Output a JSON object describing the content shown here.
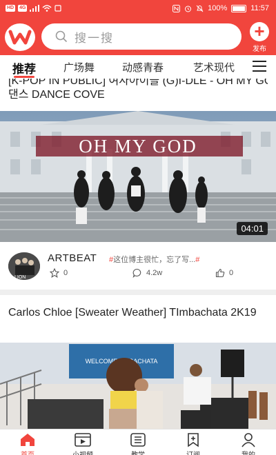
{
  "status_bar": {
    "left_badge_1": "HD",
    "left_badge_2": "4G",
    "battery_percent": "100%",
    "time": "11:57"
  },
  "header": {
    "search_placeholder": "搜一搜",
    "publish_label": "发布",
    "accent_color": "#f1453d"
  },
  "tabs": [
    {
      "label": "推荐",
      "active": true
    },
    {
      "label": "广场舞",
      "active": false
    },
    {
      "label": "动感青春",
      "active": false
    },
    {
      "label": "艺术现代",
      "active": false
    }
  ],
  "feed": [
    {
      "title_line1": "[K-POP IN PUBLIC] 여자아이들 (G)I-DLE - OH MY GOD + 커버",
      "title_line2": "댄스 DANCE COVE",
      "thumbnail_text": "OH MY GOD",
      "duration": "04:01",
      "author": "ARTBEAT",
      "hashtag": "这位博主很忙，忘了写...",
      "likes_star": "0",
      "comments": "4.2w",
      "thumbs": "0"
    },
    {
      "title": "Carlos  Chloe [Sweater Weather] TImbachata  2K19",
      "banner_text": "WELCOME TO BACHATA"
    }
  ],
  "bottom_nav": [
    {
      "label": "首页",
      "icon": "home-icon",
      "active": true
    },
    {
      "label": "小视频",
      "icon": "video-icon",
      "active": false
    },
    {
      "label": "教学",
      "icon": "teach-icon",
      "active": false
    },
    {
      "label": "订阅",
      "icon": "subscribe-icon",
      "active": false
    },
    {
      "label": "我的",
      "icon": "user-icon",
      "active": false
    }
  ]
}
